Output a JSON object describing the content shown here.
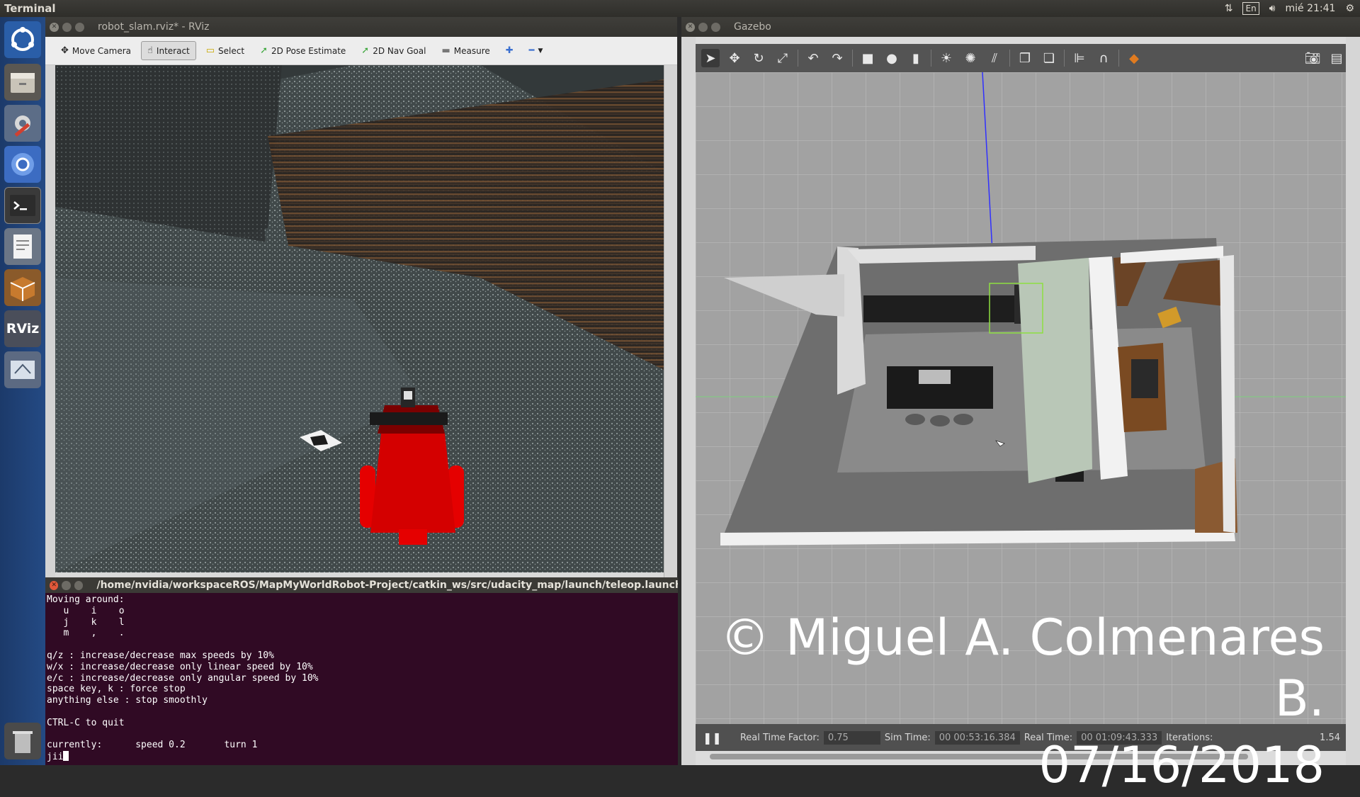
{
  "top_panel": {
    "app_title": "Terminal",
    "keyboard": "En",
    "clock": "mié 21:41"
  },
  "launcher": {
    "items": [
      "ubuntu-dash-icon",
      "files-icon",
      "system-settings-icon",
      "chromium-icon",
      "terminal-icon",
      "text-editor-icon",
      "software-box-icon",
      "rviz-icon",
      "rqt-icon",
      "trash-icon"
    ],
    "rviz_label": "RViz"
  },
  "rviz": {
    "title": "robot_slam.rviz* - RViz",
    "tools": {
      "move_camera": "Move Camera",
      "interact": "Interact",
      "select": "Select",
      "pose_estimate": "2D Pose Estimate",
      "nav_goal": "2D Nav Goal",
      "measure": "Measure"
    }
  },
  "terminal": {
    "title": "/home/nvidia/workspaceROS/MapMyWorldRobot-Project/catkin_ws/src/udacity_map/launch/teleop.launch htt",
    "lines": {
      "l1": "Moving around:",
      "l2": "   u    i    o",
      "l3": "   j    k    l",
      "l4": "   m    ,    .",
      "l5": "",
      "l6": "q/z : increase/decrease max speeds by 10%",
      "l7": "w/x : increase/decrease only linear speed by 10%",
      "l8": "e/c : increase/decrease only angular speed by 10%",
      "l9": "space key, k : force stop",
      "l10": "anything else : stop smoothly",
      "l11": "",
      "l12": "CTRL-C to quit",
      "l13": "",
      "l14": "currently:      speed 0.2       turn 1",
      "l15": "jii"
    }
  },
  "gazebo": {
    "title": "Gazebo",
    "bottom": {
      "rtf_label": "Real Time Factor:",
      "rtf_value": "0.75",
      "sim_label": "Sim Time:",
      "sim_value": "00 00:53:16.384",
      "real_label": "Real Time:",
      "real_value": "00 01:09:43.333",
      "iter_label": "Iterations:",
      "fps_value": "1.54"
    }
  },
  "watermark": {
    "line1": "© Miguel A. Colmenares B.",
    "line2": "07/16/2018"
  },
  "colors": {
    "launcher": "#244a84",
    "terminal_bg": "#300a24",
    "robot_red": "#e50000",
    "gazebo_ground": "#9c9c9c"
  }
}
